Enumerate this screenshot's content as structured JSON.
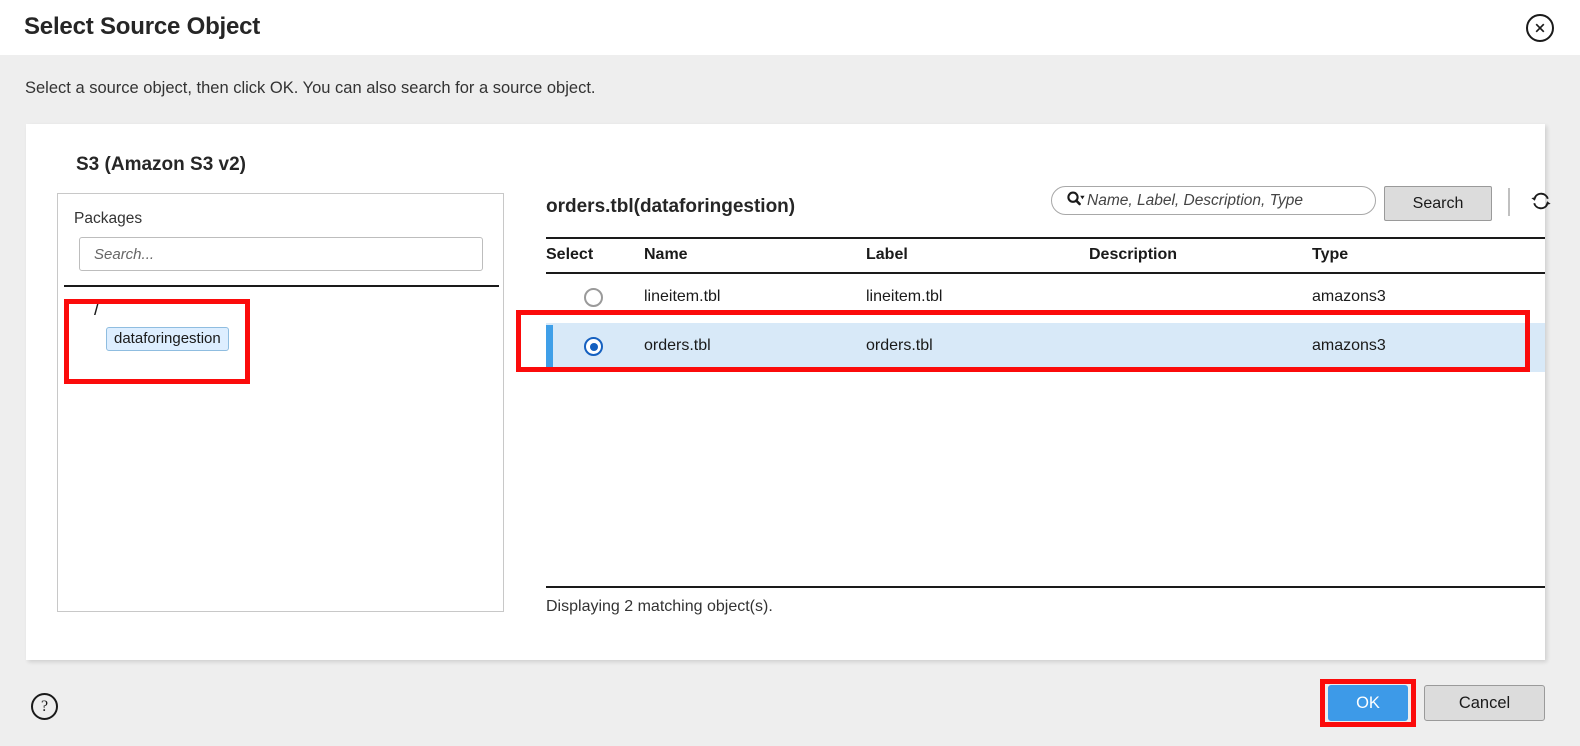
{
  "dialog": {
    "title": "Select Source Object",
    "subtitle": "Select a source object, then click OK. You can also search for a source object.",
    "close_icon": "close-icon"
  },
  "section": {
    "title": "S3 (Amazon S3 v2)"
  },
  "packages": {
    "label": "Packages",
    "search_placeholder": "Search...",
    "search_value": "",
    "tree": {
      "root": "/",
      "nodes": [
        {
          "label": "dataforingestion",
          "selected": true
        }
      ]
    }
  },
  "objects": {
    "title": "orders.tbl(dataforingestion)",
    "search": {
      "icon": "search-icon",
      "dropdown_icon": "chevron-down-icon",
      "placeholder": "Name, Label, Description, Type",
      "value": "",
      "button_label": "Search",
      "refresh_icon": "refresh-icon"
    },
    "columns": [
      "Select",
      "Name",
      "Label",
      "Description",
      "Type"
    ],
    "rows": [
      {
        "selected": false,
        "name": "lineitem.tbl",
        "label": "lineitem.tbl",
        "description": "",
        "type": "amazons3"
      },
      {
        "selected": true,
        "name": "orders.tbl",
        "label": "orders.tbl",
        "description": "",
        "type": "amazons3"
      }
    ],
    "status": "Displaying 2 matching object(s)."
  },
  "footer": {
    "help_icon": "question-mark-icon",
    "help_glyph": "?",
    "ok_label": "OK",
    "cancel_label": "Cancel"
  },
  "colors": {
    "accent_blue": "#3d9ae8",
    "row_selected_bg": "#d8e9f8",
    "annotation_red": "#fb0b0b",
    "chip_bg": "#ddeeff",
    "panel_bg": "#ffffff",
    "body_bg": "#eeeeee"
  }
}
